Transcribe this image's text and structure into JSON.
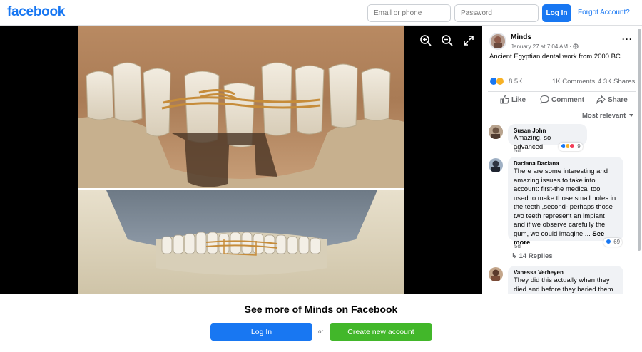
{
  "header": {
    "logo": "facebook",
    "email_placeholder": "Email or phone",
    "password_placeholder": "Password",
    "login_label": "Log In",
    "forgot_label": "Forgot Account?"
  },
  "viewer": {
    "tools": [
      "zoom-in-icon",
      "zoom-out-icon",
      "fullscreen-icon"
    ]
  },
  "post": {
    "page_name": "Minds",
    "meta": "January 27 at 7:04 AM ·",
    "caption": "Ancient Egyptian dental work from 2000 BC",
    "reaction_count": "8.5K",
    "comment_count": "1K Comments",
    "share_count": "4.3K Shares",
    "actions": {
      "like": "Like",
      "comment": "Comment",
      "share": "Share"
    },
    "sort_label": "Most relevant"
  },
  "comments": [
    {
      "author": "Susan John",
      "text": "Amazing, so advanced!",
      "time": "5d",
      "reactions": "9"
    },
    {
      "author": "Daciana Daciana",
      "text": "There are some interesting and amazing issues to take into account: first-the medical tool used to make those small holes in the teeth ,second- perhaps those two teeth represent an implant and if we observe carefully the gum, we could imagine ...",
      "see_more": "See more",
      "time": "5d",
      "reactions": "69",
      "replies": "14 Replies"
    },
    {
      "author": "Vanessa Verheyen",
      "text": "They did this actually when they died and before they baried them."
    }
  ],
  "banner": {
    "title": "See more of Minds on Facebook",
    "login_label": "Log In",
    "or_label": "or",
    "create_label": "Create new account"
  },
  "colors": {
    "brand": "#1877f2",
    "create_green": "#42b72a",
    "comment_bg": "#f0f2f5",
    "muted_text": "#65676b"
  }
}
